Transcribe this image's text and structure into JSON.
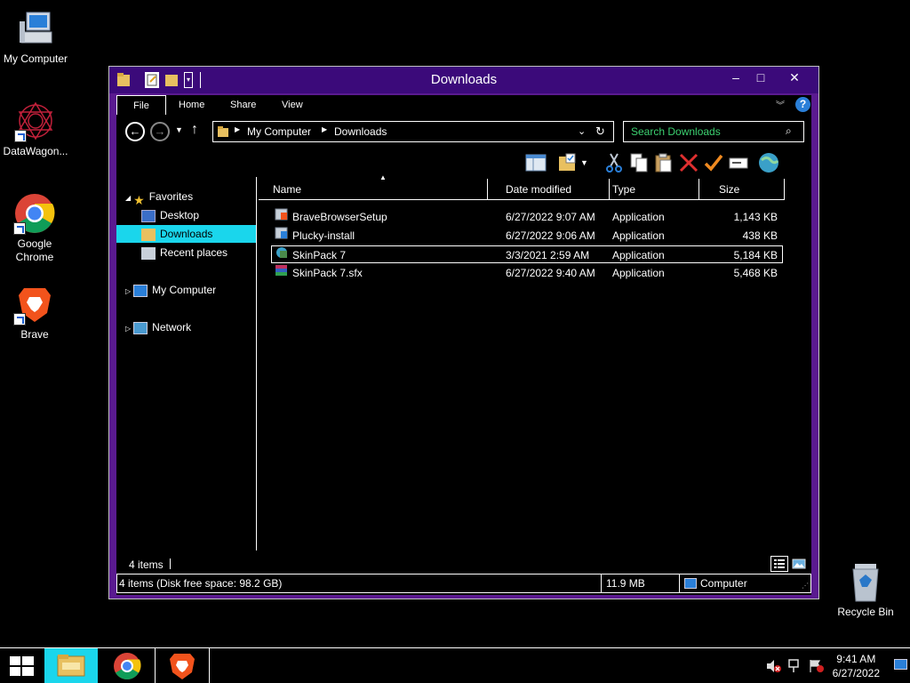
{
  "desktop": {
    "icons": [
      {
        "label": "My Computer",
        "icon": "computer-icon"
      },
      {
        "label": "DataWagon...",
        "icon": "datawagon-icon"
      },
      {
        "label": "Google Chrome",
        "icon": "chrome-icon"
      },
      {
        "label": "Brave",
        "icon": "brave-icon"
      },
      {
        "label": "Recycle Bin",
        "icon": "recycle-bin-icon"
      }
    ]
  },
  "window": {
    "title": "Downloads",
    "controls": {
      "minimize": "–",
      "maximize": "□",
      "close": "✕"
    },
    "ribbon_tabs": [
      "File",
      "Home",
      "Share",
      "View"
    ],
    "help": "?",
    "address": {
      "segments": [
        "My Computer",
        "Downloads"
      ]
    },
    "search": {
      "placeholder": "Search Downloads"
    },
    "nav_pane": {
      "favorites": "Favorites",
      "items": [
        "Desktop",
        "Downloads",
        "Recent places"
      ],
      "my_computer": "My Computer",
      "network": "Network"
    },
    "columns": [
      "Name",
      "Date modified",
      "Type",
      "Size"
    ],
    "files": [
      {
        "name": "BraveBrowserSetup",
        "date": "6/27/2022 9:07 AM",
        "type": "Application",
        "size": "1,143 KB"
      },
      {
        "name": "Plucky-install",
        "date": "6/27/2022 9:06 AM",
        "type": "Application",
        "size": "438 KB"
      },
      {
        "name": "SkinPack 7",
        "date": "3/3/2021 2:59 AM",
        "type": "Application",
        "size": "5,184 KB"
      },
      {
        "name": "SkinPack 7.sfx",
        "date": "6/27/2022 9:40 AM",
        "type": "Application",
        "size": "5,468 KB"
      }
    ],
    "item_count": "4 items",
    "status": {
      "disk": "4 items (Disk free space: 98.2 GB)",
      "size": "11.9 MB",
      "location": "Computer"
    }
  },
  "taskbar": {
    "time": "9:41 AM",
    "date": "6/27/2022"
  },
  "colors": {
    "accent": "#3b0a7a",
    "selection": "#1ad6ec",
    "search_text": "#3cd070"
  }
}
